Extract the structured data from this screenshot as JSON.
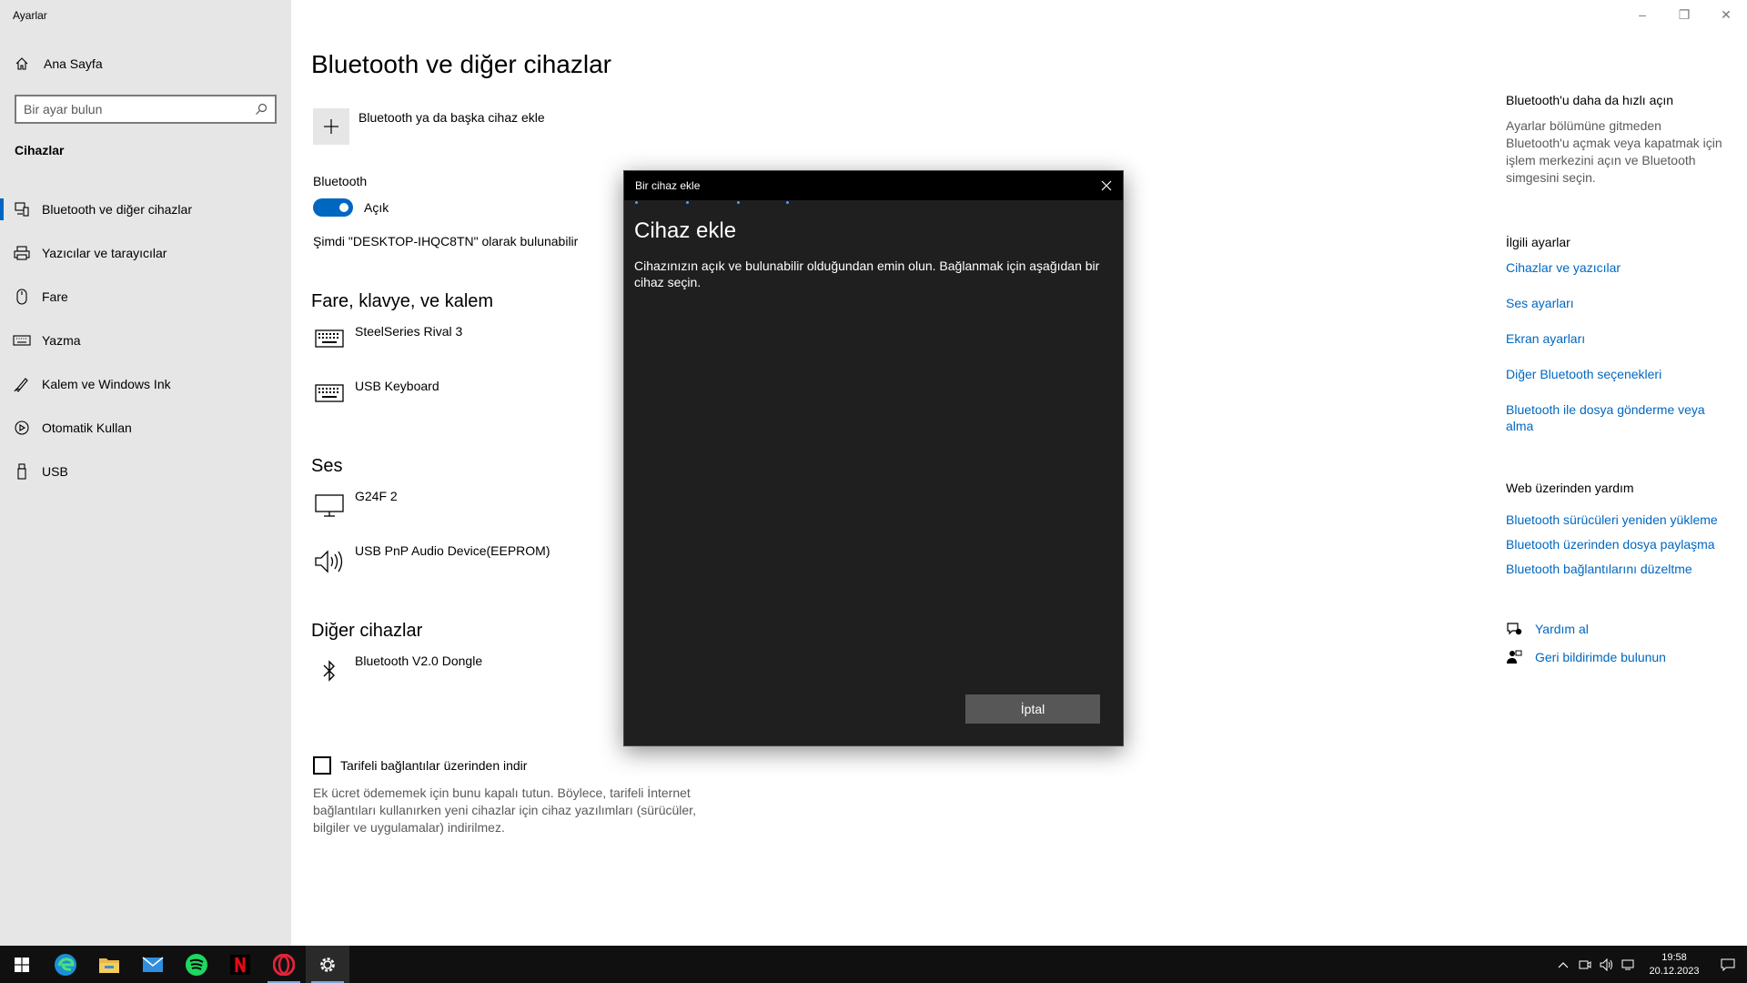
{
  "window": {
    "app_title": "Ayarlar",
    "controls": {
      "minimize": "–",
      "restore": "❐",
      "close": "✕"
    }
  },
  "sidebar": {
    "home_label": "Ana Sayfa",
    "search_placeholder": "Bir ayar bulun",
    "section_label": "Cihazlar",
    "items": [
      {
        "label": "Bluetooth ve diğer cihazlar",
        "icon": "bluetooth-devices-icon",
        "active": true
      },
      {
        "label": "Yazıcılar ve tarayıcılar",
        "icon": "printer-icon"
      },
      {
        "label": "Fare",
        "icon": "mouse-icon"
      },
      {
        "label": "Yazma",
        "icon": "keyboard-icon"
      },
      {
        "label": "Kalem ve Windows Ink",
        "icon": "pen-icon"
      },
      {
        "label": "Otomatik Kullan",
        "icon": "autoplay-icon"
      },
      {
        "label": "USB",
        "icon": "usb-icon"
      }
    ]
  },
  "main": {
    "title": "Bluetooth ve diğer cihazlar",
    "add_device_label": "Bluetooth ya da başka cihaz ekle",
    "bluetooth_label": "Bluetooth",
    "toggle_state": "Açık",
    "discoverable_text": "Şimdi \"DESKTOP-IHQC8TN\" olarak bulunabilir",
    "groups": {
      "input": {
        "title": "Fare, klavye, ve kalem",
        "devices": [
          "SteelSeries Rival 3",
          "USB Keyboard"
        ]
      },
      "audio": {
        "title": "Ses",
        "devices": [
          "G24F 2",
          "USB PnP Audio Device(EEPROM)"
        ]
      },
      "other": {
        "title": "Diğer cihazlar",
        "devices": [
          "Bluetooth V2.0 Dongle"
        ]
      }
    },
    "metered_label": "Tarifeli bağlantılar üzerinden indir",
    "metered_desc": "Ek ücret ödememek için bunu kapalı tutun. Böylece, tarifeli İnternet bağlantıları kullanırken yeni cihazlar için cihaz yazılımları (sürücüler, bilgiler ve uygulamalar) indirilmez."
  },
  "right": {
    "quick_title": "Bluetooth'u daha da hızlı açın",
    "quick_text": "Ayarlar bölümüne gitmeden Bluetooth'u açmak veya kapatmak için işlem merkezini açın ve Bluetooth simgesini seçin.",
    "related_title": "İlgili ayarlar",
    "related_links": [
      "Cihazlar ve yazıcılar",
      "Ses ayarları",
      "Ekran ayarları",
      "Diğer Bluetooth seçenekleri",
      "Bluetooth ile dosya gönderme veya alma"
    ],
    "web_title": "Web üzerinden yardım",
    "web_links": [
      "Bluetooth sürücüleri yeniden yükleme",
      "Bluetooth üzerinden dosya paylaşma",
      "Bluetooth bağlantılarını düzeltme"
    ],
    "help_link": "Yardım al",
    "feedback_link": "Geri bildirimde bulunun"
  },
  "dialog": {
    "title": "Bir cihaz ekle",
    "heading": "Cihaz ekle",
    "description": "Cihazınızın açık ve bulunabilir olduğundan emin olun. Bağlanmak için aşağıdan bir cihaz seçin.",
    "cancel_label": "İptal"
  },
  "taskbar": {
    "apps": [
      "start",
      "edge",
      "file-explorer",
      "mail",
      "spotify",
      "netflix",
      "opera",
      "settings"
    ],
    "time": "19:58",
    "date": "20.12.2023"
  },
  "colors": {
    "accent": "#0067c0",
    "dialog_bg": "#1f1f1f",
    "taskbar_bg": "#101010"
  }
}
